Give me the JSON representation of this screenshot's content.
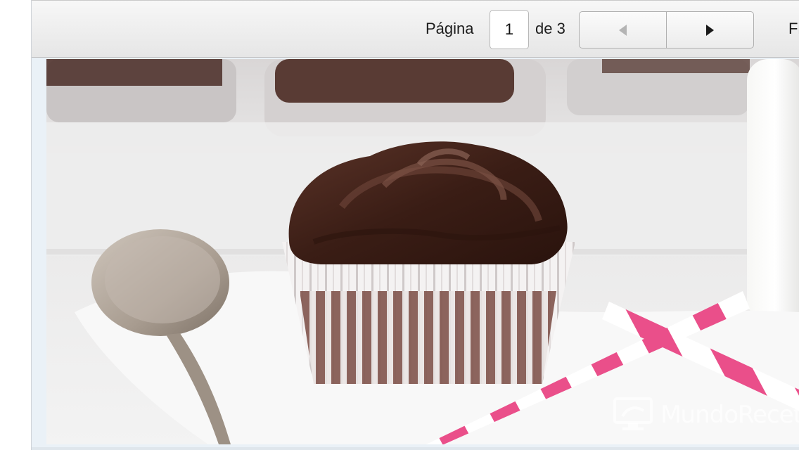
{
  "toolbar": {
    "page_label": "Página",
    "current_page": "1",
    "of_label": "de 3",
    "prev_icon": "triangle-left-icon",
    "next_icon": "triangle-right-icon",
    "filter_label": "Filtra"
  },
  "photo": {
    "watermark_text": "MundoRecet"
  },
  "colors": {
    "toolbar_bg": "#ececec",
    "chocolate": "#3b1f17",
    "straw_pink": "#ea4f8a"
  }
}
